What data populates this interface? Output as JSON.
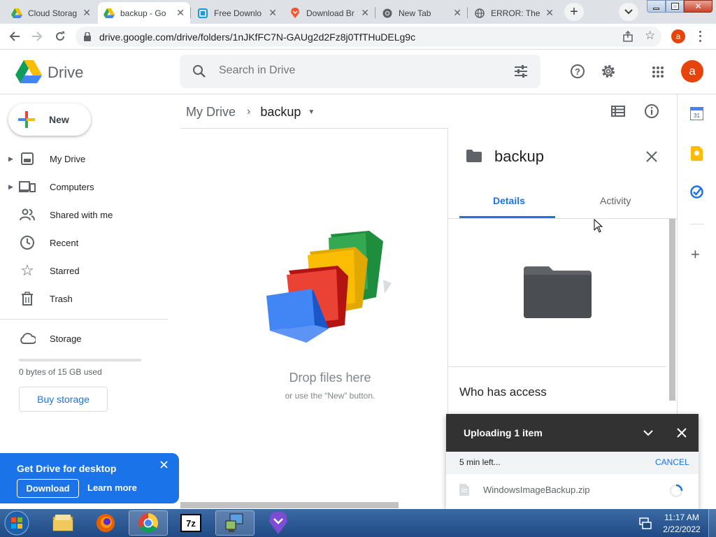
{
  "browser": {
    "tabs": [
      {
        "title": "Cloud Storag",
        "active": false
      },
      {
        "title": "backup - Go",
        "active": true
      },
      {
        "title": "Free Downlo",
        "active": false
      },
      {
        "title": "Download Br",
        "active": false
      },
      {
        "title": "New Tab",
        "active": false
      },
      {
        "title": "ERROR: The",
        "active": false
      }
    ],
    "url": "drive.google.com/drive/folders/1nJKfFC7N-GAUg2d2Fz8j0TfTHuDELg9c",
    "profile_initial": "a"
  },
  "header": {
    "app_name": "Drive",
    "search_placeholder": "Search in Drive",
    "avatar_initial": "a"
  },
  "sidebar": {
    "new_label": "New",
    "items": [
      {
        "label": "My Drive",
        "icon": "my-drive-icon"
      },
      {
        "label": "Computers",
        "icon": "computers-icon"
      },
      {
        "label": "Shared with me",
        "icon": "shared-icon"
      },
      {
        "label": "Recent",
        "icon": "clock-icon"
      },
      {
        "label": "Starred",
        "icon": "star-icon"
      },
      {
        "label": "Trash",
        "icon": "trash-icon"
      }
    ],
    "storage": {
      "label": "Storage",
      "used_text": "0 bytes of 15 GB used",
      "buy_label": "Buy storage",
      "used_fraction": 0
    }
  },
  "breadcrumb": {
    "root": "My Drive",
    "current": "backup"
  },
  "empty_state": {
    "title": "Drop files here",
    "subtitle": "or use the “New” button."
  },
  "details": {
    "folder_name": "backup",
    "tabs": [
      "Details",
      "Activity"
    ],
    "active_tab": "Details",
    "access_heading": "Who has access"
  },
  "upload": {
    "title": "Uploading 1 item",
    "time_left": "5 min left...",
    "cancel_label": "CANCEL",
    "file_name": "WindowsImageBackup.zip"
  },
  "promo": {
    "title": "Get Drive for desktop",
    "download_label": "Download",
    "learn_more_label": "Learn more"
  },
  "taskbar": {
    "time": "11:17 AM",
    "date": "2/22/2022"
  },
  "colors": {
    "accent": "#1a73e8",
    "avatar": "#e8430a"
  }
}
